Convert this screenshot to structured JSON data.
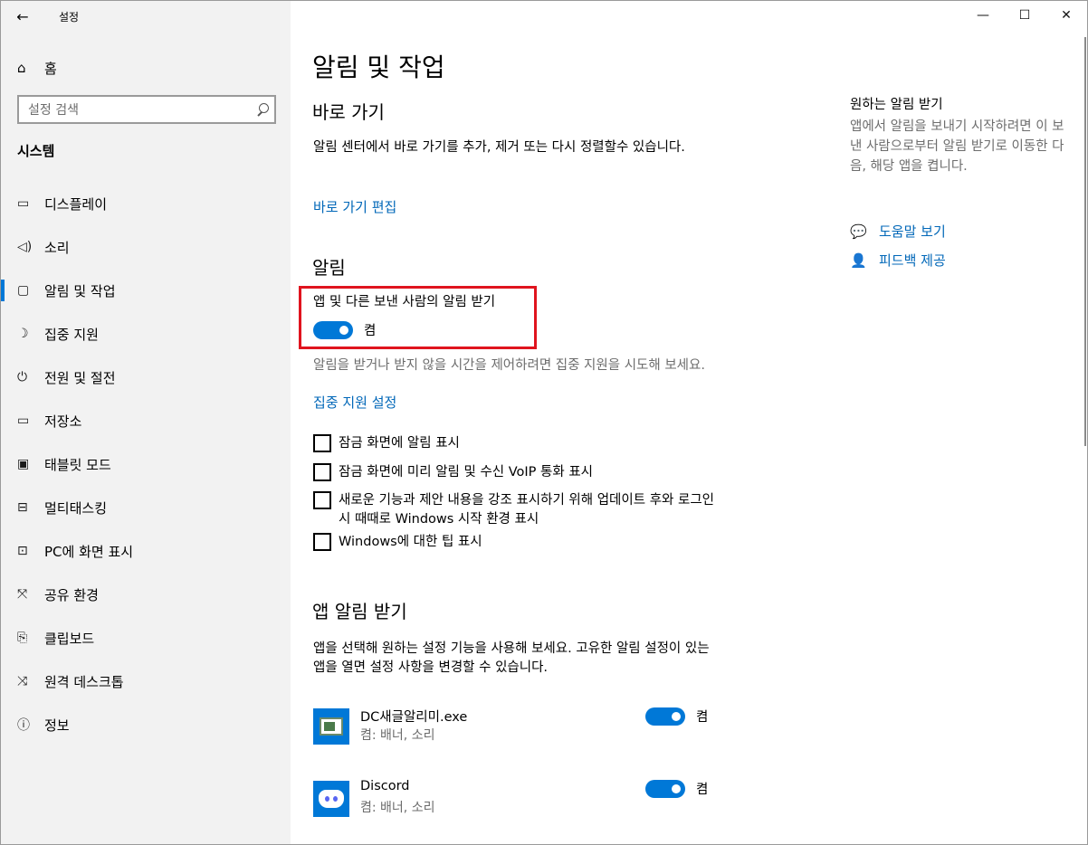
{
  "window": {
    "app_title": "설정"
  },
  "sidebar": {
    "home_label": "홈",
    "search_placeholder": "설정 검색",
    "category": "시스템",
    "items": [
      {
        "label": "디스플레이",
        "icon": "display-icon"
      },
      {
        "label": "소리",
        "icon": "speaker-icon"
      },
      {
        "label": "알림 및 작업",
        "icon": "notification-icon",
        "active": true
      },
      {
        "label": "집중 지원",
        "icon": "moon-icon"
      },
      {
        "label": "전원 및 절전",
        "icon": "power-icon"
      },
      {
        "label": "저장소",
        "icon": "storage-icon"
      },
      {
        "label": "태블릿 모드",
        "icon": "tablet-icon"
      },
      {
        "label": "멀티태스킹",
        "icon": "multitask-icon"
      },
      {
        "label": "PC에 화면 표시",
        "icon": "project-icon"
      },
      {
        "label": "공유 환경",
        "icon": "share-icon"
      },
      {
        "label": "클립보드",
        "icon": "clipboard-icon"
      },
      {
        "label": "원격 데스크톱",
        "icon": "remote-icon"
      },
      {
        "label": "정보",
        "icon": "info-icon"
      }
    ]
  },
  "main": {
    "title": "알림 및 작업",
    "quick": {
      "heading": "바로 가기",
      "desc": "알림 센터에서 바로 가기를 추가, 제거 또는 다시 정렬할수 있습니다.",
      "link": "바로 가기 편집"
    },
    "notifications": {
      "heading": "알림",
      "toggle_label": "앱 및 다른 보낸 사람의 알림 받기",
      "toggle_state": "켬",
      "hint": "알림을 받거나 받지 않을 시간을 제어하려면 집중 지원을 시도해 보세요.",
      "link": "집중 지원 설정",
      "checkboxes": [
        "잠금 화면에 알림 표시",
        "잠금 화면에 미리 알림 및 수신 VoIP 통화 표시",
        "새로운 기능과 제안 내용을 강조 표시하기 위해 업데이트 후와 로그인 시 때때로 Windows 시작 환경 표시",
        "Windows에 대한 팁 표시"
      ]
    },
    "apps": {
      "heading": "앱 알림 받기",
      "desc": "앱을 선택해 원하는 설정 기능을 사용해 보세요. 고유한 알림 설정이 있는 앱을 열면 설정 사항을 변경할 수 있습니다.",
      "list": [
        {
          "name": "DC새글알리미.exe",
          "sub": "켬: 배너, 소리",
          "state": "켬"
        },
        {
          "name": "Discord",
          "sub": "켬: 배너, 소리",
          "state": "켬"
        }
      ]
    }
  },
  "right": {
    "title": "원하는 알림 받기",
    "desc": "앱에서 알림을 보내기 시작하려면 이 보낸 사람으로부터 알림 받기로 이동한 다음, 해당 앱을 켭니다.",
    "help": "도움말 보기",
    "feedback": "피드백 제공"
  },
  "colors": {
    "accent": "#0078d7",
    "link": "#0067b8",
    "highlight": "#e0141e"
  }
}
